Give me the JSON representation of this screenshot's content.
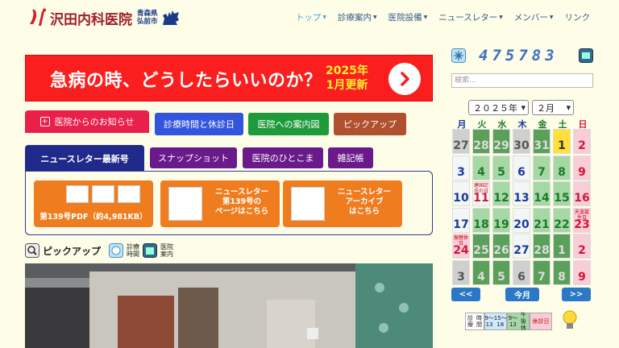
{
  "header": {
    "logo_text": "沢田内科医院",
    "logo_sub1": "青森県",
    "logo_sub2": "弘前市",
    "nav": [
      "トップ",
      "診療案内",
      "医院設備",
      "ニュースレター",
      "メンバー",
      "リンク"
    ]
  },
  "banner": {
    "title": "急病の時、どうしたらいいのか？",
    "sub1": "2025年",
    "sub2": "1月更新"
  },
  "tabs_row1": {
    "news": "医院からのお知らせ",
    "hours": "診療時間と休診日",
    "access": "医院への案内図",
    "pickup": "ピックアップ"
  },
  "tabs_row2": {
    "letter": "ニュースレター最新号",
    "snap": "スナップショット",
    "hito": "医院のひとこま",
    "zakki": "雑記帳"
  },
  "cards": [
    {
      "line1": "第139号PDF（約4,981KB）"
    },
    {
      "line1": "ニュースレター",
      "line2": "第139号の",
      "line3": "ページはこちら"
    },
    {
      "line1": "ニュースレター",
      "line2": "アーカイブ",
      "line3": "はこちら"
    }
  ],
  "pickup": {
    "label": "ピックアップ",
    "icon1_a": "診療",
    "icon1_b": "時間",
    "icon2_a": "医院",
    "icon2_b": "案内"
  },
  "counter": "475783",
  "search_placeholder": "検索...",
  "calendar": {
    "year": "２０２５年",
    "month": "２月",
    "dow": [
      "月",
      "火",
      "水",
      "木",
      "金",
      "土",
      "日"
    ],
    "weeks": [
      [
        {
          "d": "27",
          "c": "gray"
        },
        {
          "d": "28",
          "c": "green"
        },
        {
          "d": "29",
          "c": "green"
        },
        {
          "d": "30",
          "c": "gray"
        },
        {
          "d": "31",
          "c": "green"
        },
        {
          "d": "1",
          "c": "yellow"
        },
        {
          "d": "2",
          "c": "pink"
        }
      ],
      [
        {
          "d": "3",
          "c": "white",
          "t": "blue"
        },
        {
          "d": "4",
          "c": "greenL"
        },
        {
          "d": "5",
          "c": "greenL"
        },
        {
          "d": "6",
          "c": "white",
          "t": "blue"
        },
        {
          "d": "7",
          "c": "greenL"
        },
        {
          "d": "8",
          "c": "greenL"
        },
        {
          "d": "9",
          "c": "pink"
        }
      ],
      [
        {
          "d": "10",
          "c": "white",
          "t": "blue"
        },
        {
          "d": "11",
          "c": "white",
          "t": "red",
          "n": "建国記念の日"
        },
        {
          "d": "12",
          "c": "greenL"
        },
        {
          "d": "13",
          "c": "white",
          "t": "blue"
        },
        {
          "d": "14",
          "c": "greenL"
        },
        {
          "d": "15",
          "c": "greenL"
        },
        {
          "d": "16",
          "c": "pink"
        }
      ],
      [
        {
          "d": "17",
          "c": "white",
          "t": "blue"
        },
        {
          "d": "18",
          "c": "greenL"
        },
        {
          "d": "19",
          "c": "greenL"
        },
        {
          "d": "20",
          "c": "white",
          "t": "blue"
        },
        {
          "d": "21",
          "c": "greenL"
        },
        {
          "d": "22",
          "c": "greenL"
        },
        {
          "d": "23",
          "c": "pink",
          "n": "天皇誕生日"
        }
      ],
      [
        {
          "d": "24",
          "c": "pink",
          "n": "振替休日"
        },
        {
          "d": "25",
          "c": "green"
        },
        {
          "d": "26",
          "c": "green"
        },
        {
          "d": "27",
          "c": "white",
          "t": "blue"
        },
        {
          "d": "28",
          "c": "green"
        },
        {
          "d": "1",
          "c": "green"
        },
        {
          "d": "2",
          "c": "pink"
        }
      ],
      [
        {
          "d": "3",
          "c": "gray"
        },
        {
          "d": "4",
          "c": "green"
        },
        {
          "d": "5",
          "c": "green"
        },
        {
          "d": "6",
          "c": "gray"
        },
        {
          "d": "7",
          "c": "green"
        },
        {
          "d": "8",
          "c": "green"
        },
        {
          "d": "9",
          "c": "pink"
        }
      ]
    ],
    "prev": "<<",
    "today": "今月",
    "next": ">>"
  },
  "legend": {
    "label_a": "診療",
    "label_b": "時間",
    "full_a": "9〜13",
    "full_b": "15〜18",
    "half_a": "9〜13",
    "half_b": "午後休",
    "closed": "休診日"
  },
  "colors": {
    "accent_red": "#fa1e1e",
    "nav_active": "#47a5d6",
    "brand": "#a0202a"
  }
}
